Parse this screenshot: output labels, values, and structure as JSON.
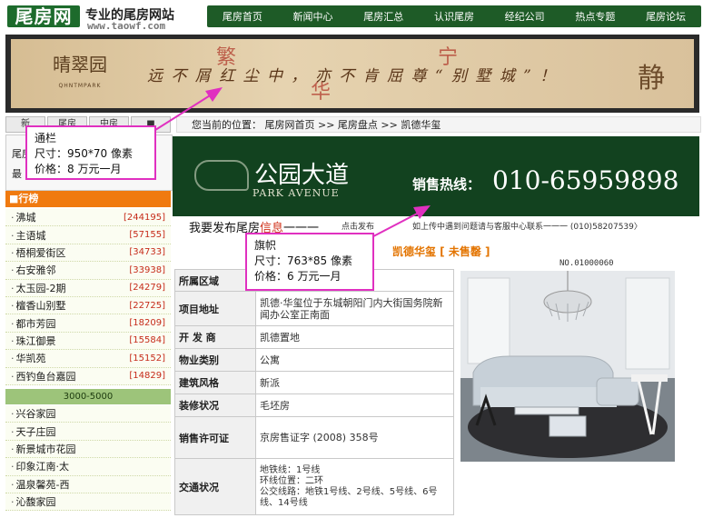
{
  "header": {
    "logo_text": "尾房网",
    "site_title": "专业的尾房网站",
    "site_url": "www.taowf.com",
    "nav": [
      "尾房首页",
      "新闻中心",
      "尾房汇总",
      "认识尾房",
      "经纪公司",
      "热点专题",
      "尾房论坛"
    ]
  },
  "banner": {
    "brand": "晴翠园",
    "brand_sub": "QHNTMPARK",
    "slogan": "远 不 屑 红 尘 中 ， 亦 不 肯 屈 尊 “ 别 墅 城 ” ！",
    "right_char": "静",
    "deco": [
      "繁",
      "华",
      "宁"
    ]
  },
  "callout_top": {
    "title": "通栏",
    "size": "尺寸：950*70 像素",
    "price": "价格：8 万元一月"
  },
  "callout_mid": {
    "title": "旗帜",
    "size": "尺寸：763*85 像素",
    "price": "价格：6 万元一月"
  },
  "left": {
    "tabs": [
      "新",
      "尾房",
      "中房",
      "■"
    ],
    "info_lines": [
      "尾房",
      "最"
    ],
    "rank_title": "■行榜",
    "ranks": [
      {
        "name": "沸城",
        "count": "[244195]"
      },
      {
        "name": "主语城",
        "count": "[57155]"
      },
      {
        "name": "梧桐爱街区",
        "count": "[34733]"
      },
      {
        "name": "右安雅邻",
        "count": "[33938]"
      },
      {
        "name": "太玉园-2期",
        "count": "[24279]"
      },
      {
        "name": "檀香山别墅",
        "count": "[22725]"
      },
      {
        "name": "都市芳园",
        "count": "[18209]"
      },
      {
        "name": "珠江御景",
        "count": "[15584]"
      },
      {
        "name": "华凯苑",
        "count": "[15152]"
      },
      {
        "name": "西钓鱼台嘉园",
        "count": "[14829]"
      }
    ],
    "range_label": "3000-5000",
    "ranks2": [
      "兴谷家园",
      "天子庄园",
      "新景城市花园",
      "印象江南·太",
      "温泉馨苑-西",
      "沁馥家园"
    ]
  },
  "crumb": "您当前的位置：  尾房网首页 >> 尾房盘点 >> 凯德华玺",
  "pa_banner": {
    "title": "公园大道",
    "subtitle": "PARK AVENUE",
    "hot_label": "销售热线：",
    "phone": "010-65959898"
  },
  "publish": {
    "main_prefix": "我要发布尾房",
    "main_highlight": "信息",
    "main_suffix": "一一一",
    "tip": "点击发布",
    "notice": "如上传中遇到问题请与客服中心联系一一一 (010)58207539〉"
  },
  "property": {
    "title": "凯德华玺 [ 未售罄 ]",
    "number": "NO.01000060",
    "rows": [
      {
        "key": "所属区域",
        "value": ""
      },
      {
        "key": "项目地址",
        "value": "凯德·华玺位于东城朝阳门内大街国务院新闻办公室正南面"
      },
      {
        "key": "开 发 商",
        "value": "凯德置地"
      },
      {
        "key": "物业类别",
        "value": "公寓"
      },
      {
        "key": "建筑风格",
        "value": "新派"
      },
      {
        "key": "装修状况",
        "value": "毛坯房"
      },
      {
        "key": "销售许可证",
        "value": "京房售证字 (2008) 358号"
      },
      {
        "key": "交通状况",
        "value": "地铁线：1号线\n环线位置：二环\n公交线路：地铁1号线、2号线、5号线、6号线、14号线"
      }
    ]
  }
}
